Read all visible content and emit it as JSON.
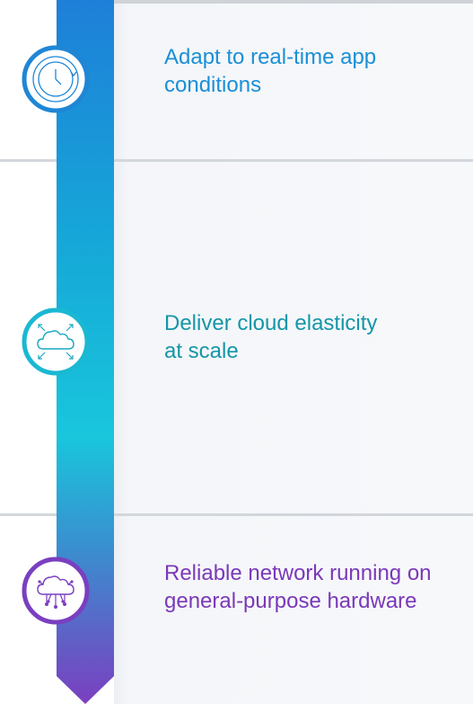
{
  "steps": [
    {
      "icon": "clock-refresh-icon",
      "label": "Adapt to real-time app conditions",
      "color": "#1a8fd6"
    },
    {
      "icon": "cloud-expand-icon",
      "label": "Deliver cloud elasticity at scale",
      "color": "#1496a8"
    },
    {
      "icon": "cloud-network-icon",
      "label": "Reliable network running on general-purpose hardware",
      "color": "#7b38b8"
    }
  ],
  "arrow": {
    "gradient": [
      "#1e7fd8",
      "#16a8d8",
      "#19c6dc",
      "#3a8ecf",
      "#7b3fc0"
    ]
  }
}
